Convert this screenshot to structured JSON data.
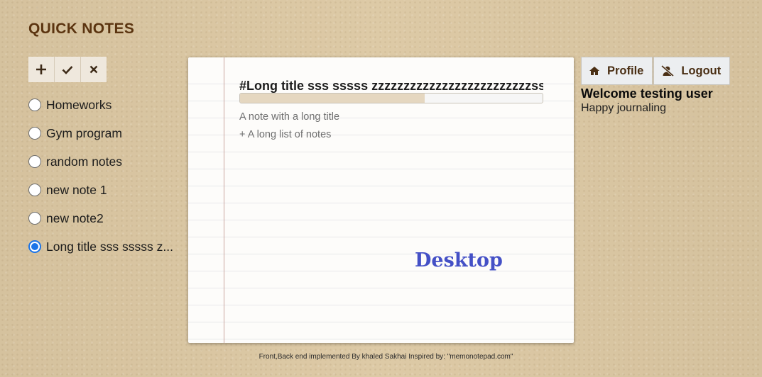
{
  "app": {
    "title": "QUICK NOTES"
  },
  "toolbar": {
    "add_icon": "plus-icon",
    "save_icon": "check-icon",
    "delete_icon": "x-icon"
  },
  "notes": [
    {
      "label": "Homeworks",
      "selected": false
    },
    {
      "label": "Gym program",
      "selected": false
    },
    {
      "label": "random notes",
      "selected": false
    },
    {
      "label": "new note 1",
      "selected": false
    },
    {
      "label": "new note2",
      "selected": false
    },
    {
      "label": "Long title sss sssss z...",
      "selected": true
    }
  ],
  "editor": {
    "title": "#Long title sss sssss zzzzzzzzzzzzzzzzzzzzzzzzzssss",
    "progress_fraction": 0.61,
    "lines": [
      "A note with a long title",
      "+ A long list of notes"
    ],
    "watermark": "Desktop"
  },
  "user": {
    "profile_label": "Profile",
    "profile_icon": "home-icon",
    "logout_label": "Logout",
    "logout_icon": "user-slash-icon",
    "welcome": "Welcome testing user",
    "tagline": "Happy journaling"
  },
  "footer": {
    "text": "Front,Back end implemented By khaled Sakhai Inspired by: \"memonotepad.com\""
  },
  "colors": {
    "title_brown": "#5b3410",
    "radio_checked": "#1b74e8",
    "watermark_blue": "#4450c6",
    "progress_fill": "#e5d7c0"
  }
}
